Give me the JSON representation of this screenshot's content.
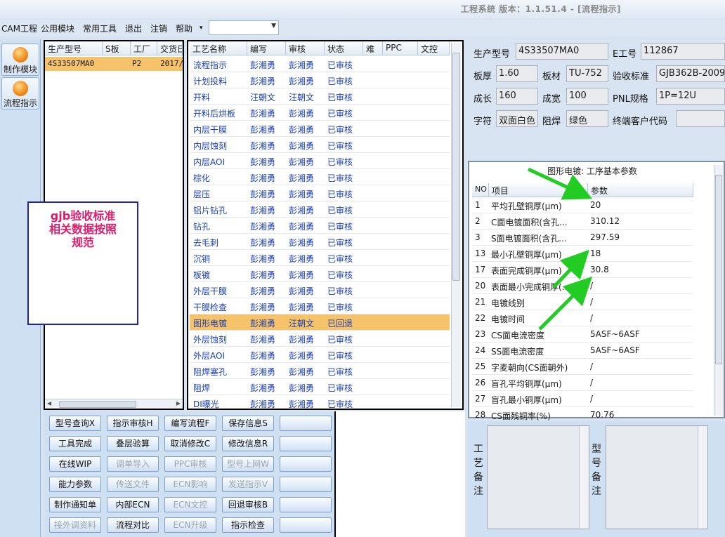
{
  "window": {
    "title": "工程系统  版本：1.1.51.4 - [流程指示]"
  },
  "menu": {
    "items": [
      "CAM工程",
      "公用模块",
      "常用工具",
      "退出",
      "注销",
      "帮助",
      "▾"
    ]
  },
  "modules": [
    {
      "label": "制作模块"
    },
    {
      "label": "流程指示"
    }
  ],
  "model_list": {
    "headers": [
      "生产型号",
      "S板",
      "工厂",
      "交货日"
    ],
    "row": {
      "model": "4S33507MA0",
      "factory": "P2",
      "date": "2017/"
    }
  },
  "note": {
    "line1": "gjb验收标准",
    "line2": "相关数据按照",
    "line3": "规范"
  },
  "process": {
    "headers": [
      "工艺名称",
      "编写",
      "审核",
      "状态",
      "难",
      "PPC",
      "文控"
    ],
    "rows": [
      {
        "name": "流程指示",
        "writer": "彭湘勇",
        "reviewer": "彭湘勇",
        "status": "已审核"
      },
      {
        "name": "计划投料",
        "writer": "彭湘勇",
        "reviewer": "彭湘勇",
        "status": "已审核"
      },
      {
        "name": "开料",
        "writer": "汪朝文",
        "reviewer": "汪朝文",
        "status": "已审核"
      },
      {
        "name": "开料后烘板",
        "writer": "彭湘勇",
        "reviewer": "彭湘勇",
        "status": "已审核"
      },
      {
        "name": "内层干膜",
        "writer": "彭湘勇",
        "reviewer": "彭湘勇",
        "status": "已审核"
      },
      {
        "name": "内层蚀刻",
        "writer": "彭湘勇",
        "reviewer": "彭湘勇",
        "status": "已审核"
      },
      {
        "name": "内层AOI",
        "writer": "彭湘勇",
        "reviewer": "彭湘勇",
        "status": "已审核"
      },
      {
        "name": "棕化",
        "writer": "彭湘勇",
        "reviewer": "彭湘勇",
        "status": "已审核"
      },
      {
        "name": "层压",
        "writer": "彭湘勇",
        "reviewer": "彭湘勇",
        "status": "已审核"
      },
      {
        "name": "铝片钻孔",
        "writer": "彭湘勇",
        "reviewer": "彭湘勇",
        "status": "已审核"
      },
      {
        "name": "钻孔",
        "writer": "彭湘勇",
        "reviewer": "彭湘勇",
        "status": "已审核"
      },
      {
        "name": "去毛刺",
        "writer": "彭湘勇",
        "reviewer": "彭湘勇",
        "status": "已审核"
      },
      {
        "name": "沉铜",
        "writer": "彭湘勇",
        "reviewer": "彭湘勇",
        "status": "已审核"
      },
      {
        "name": "板镀",
        "writer": "彭湘勇",
        "reviewer": "彭湘勇",
        "status": "已审核"
      },
      {
        "name": "外层干膜",
        "writer": "彭湘勇",
        "reviewer": "彭湘勇",
        "status": "已审核"
      },
      {
        "name": "干膜检查",
        "writer": "彭湘勇",
        "reviewer": "彭湘勇",
        "status": "已审核"
      },
      {
        "name": "图形电镀",
        "writer": "彭湘勇",
        "reviewer": "汪朝文",
        "status": "已回退"
      },
      {
        "name": "外层蚀刻",
        "writer": "彭湘勇",
        "reviewer": "彭湘勇",
        "status": "已审核"
      },
      {
        "name": "外层AOI",
        "writer": "彭湘勇",
        "reviewer": "彭湘勇",
        "status": "已审核"
      },
      {
        "name": "阻焊塞孔",
        "writer": "彭湘勇",
        "reviewer": "彭湘勇",
        "status": "已审核"
      },
      {
        "name": "阻焊",
        "writer": "彭湘勇",
        "reviewer": "彭湘勇",
        "status": "已审核"
      },
      {
        "name": "DI曝光",
        "writer": "彭湘勇",
        "reviewer": "彭湘勇",
        "status": "已审核"
      }
    ]
  },
  "buttons": [
    {
      "label": "型号查询X",
      "enabled": true
    },
    {
      "label": "指示审核H",
      "enabled": true
    },
    {
      "label": "编写流程F",
      "enabled": true
    },
    {
      "label": "保存信息S",
      "enabled": true
    },
    {
      "label": "",
      "enabled": true
    },
    {
      "label": "工具完成",
      "enabled": true
    },
    {
      "label": "叠层验算",
      "enabled": true
    },
    {
      "label": "取消修改C",
      "enabled": true
    },
    {
      "label": "修改信息R",
      "enabled": true
    },
    {
      "label": "",
      "enabled": true
    },
    {
      "label": "在线WIP",
      "enabled": true
    },
    {
      "label": "调单导入",
      "enabled": false
    },
    {
      "label": "PPC审核",
      "enabled": false
    },
    {
      "label": "型号上网W",
      "enabled": false
    },
    {
      "label": "",
      "enabled": true
    },
    {
      "label": "能力参数",
      "enabled": true
    },
    {
      "label": "传送文件",
      "enabled": false
    },
    {
      "label": "ECN影响",
      "enabled": false
    },
    {
      "label": "发送指示V",
      "enabled": false
    },
    {
      "label": "",
      "enabled": true
    },
    {
      "label": "制作通知单",
      "enabled": true
    },
    {
      "label": "内部ECN",
      "enabled": true
    },
    {
      "label": "ECN文控",
      "enabled": false
    },
    {
      "label": "回退审核B",
      "enabled": true
    },
    {
      "label": "",
      "enabled": true
    },
    {
      "label": "接外调资料",
      "enabled": false
    },
    {
      "label": "流程对比",
      "enabled": true
    },
    {
      "label": "ECN升级",
      "enabled": false
    },
    {
      "label": "指示检查",
      "enabled": true
    },
    {
      "label": "",
      "enabled": true
    }
  ],
  "info": {
    "model_label": "生产型号",
    "model_value": "4S33507MA0",
    "eno_label": "E工号",
    "eno_value": "112867",
    "thick_label": "板厚",
    "thick_value": "1.60",
    "mat_label": "板材",
    "mat_value": "TU-752",
    "std_label": "验收标准",
    "std_value": "GJB362B-2009",
    "len_label": "成长",
    "len_value": "160",
    "wid_label": "成宽",
    "wid_value": "100",
    "pnl_label": "PNL规格",
    "pnl_value": "1P=12U",
    "char_label": "字符",
    "char_value": "双面白色",
    "mask_label": "阻焊",
    "mask_value": "绿色",
    "cust_label": "终端客户代码",
    "cust_value": ""
  },
  "params": {
    "title": "图形电镀: 工序基本参数",
    "headers": [
      "NO",
      "项目",
      "参数"
    ],
    "rows": [
      {
        "no": "1",
        "item": "平均孔壁铜厚(μm)",
        "value": "20"
      },
      {
        "no": "2",
        "item": "C面电镀面积(含孔...",
        "value": "310.12"
      },
      {
        "no": "3",
        "item": "S面电镀面积(含孔...",
        "value": "297.59"
      },
      {
        "no": "13",
        "item": "最小孔壁铜厚(μm)",
        "value": "18"
      },
      {
        "no": "17",
        "item": "表面完成铜厚(μm)",
        "value": "30.8"
      },
      {
        "no": "20",
        "item": "表面最小完成铜厚(...",
        "value": "/"
      },
      {
        "no": "21",
        "item": "电镀线别",
        "value": "/"
      },
      {
        "no": "22",
        "item": "电镀时间",
        "value": "/"
      },
      {
        "no": "23",
        "item": "CS面电流密度",
        "value": "5ASF~6ASF"
      },
      {
        "no": "24",
        "item": "SS面电流密度",
        "value": "5ASF~6ASF"
      },
      {
        "no": "25",
        "item": "字麦朝向(CS面朝外)",
        "value": "/"
      },
      {
        "no": "26",
        "item": "盲孔平均铜厚(μm)",
        "value": "/"
      },
      {
        "no": "27",
        "item": "盲孔最小铜厚(μm)",
        "value": "/"
      },
      {
        "no": "28",
        "item": "CS面残铜率(%)",
        "value": "70.76"
      }
    ]
  },
  "remarks": {
    "process_label": "工艺备注",
    "model_label": "型号备注"
  },
  "colors": {
    "selected_row": "#f6c36b",
    "note_text": "#e01b6b",
    "note_border": "#2323a8",
    "arrow": "#22cc22"
  }
}
